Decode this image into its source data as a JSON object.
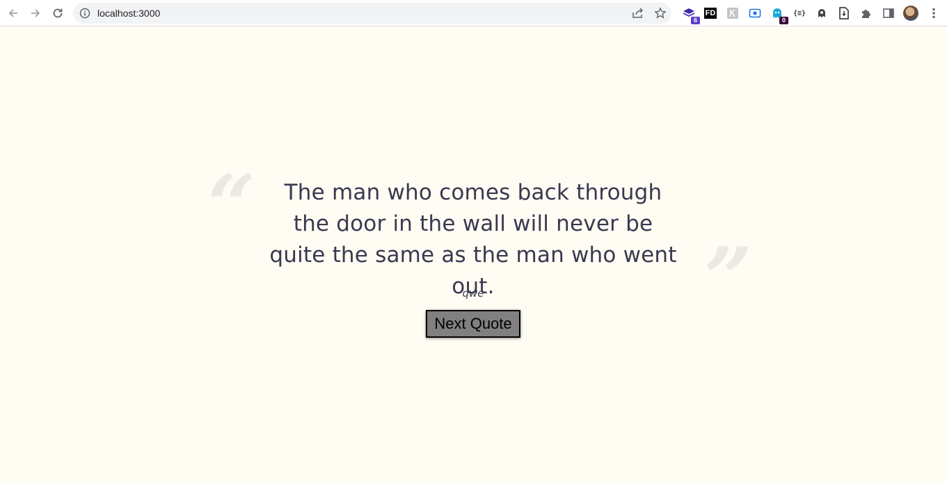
{
  "browser": {
    "url": "localhost:3000",
    "extensions": [
      {
        "name": "stack-extension",
        "badge": "6",
        "badge_color": "#5b3fc8"
      },
      {
        "name": "fd-extension",
        "label": "FD"
      },
      {
        "name": "grey-extension"
      },
      {
        "name": "capture-extension"
      },
      {
        "name": "blue-ghost-extension",
        "badge": "0",
        "badge_color": "#3a0a3a"
      },
      {
        "name": "json-extension",
        "label": "{≡}"
      },
      {
        "name": "ghost-extension"
      },
      {
        "name": "file-extension"
      }
    ]
  },
  "quote": {
    "text": "The man who comes back through the door in the wall will never be quite the same as the man who went out.",
    "author": "qwe",
    "open_mark": "“",
    "close_mark": "”"
  },
  "actions": {
    "next_label": "Next Quote"
  },
  "colors": {
    "page_background": "#fffcf3",
    "text": "#3a3850",
    "button_background": "#808080"
  }
}
